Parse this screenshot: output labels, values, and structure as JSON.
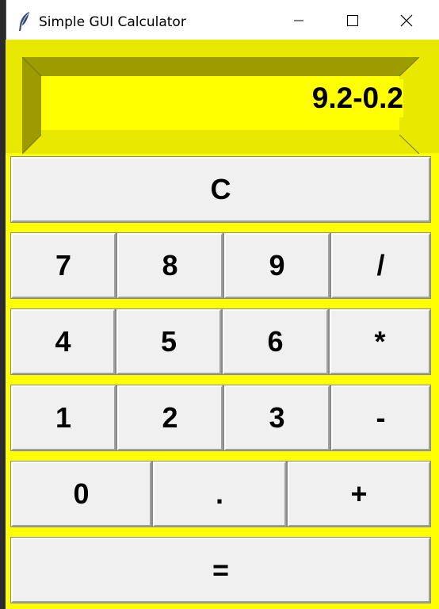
{
  "window": {
    "title": "Simple GUI Calculator",
    "controls": {
      "minimize_icon": "minimize-icon",
      "maximize_icon": "maximize-icon",
      "close_icon": "close-icon"
    },
    "app_icon": "feather-icon"
  },
  "display": {
    "value": "9.2-0.2"
  },
  "colors": {
    "background": "#ffff00",
    "frame": "#e8e800",
    "button_face": "#f0f0f0",
    "text": "#000000"
  },
  "keys": {
    "clear": "C",
    "seven": "7",
    "eight": "8",
    "nine": "9",
    "divide": "/",
    "four": "4",
    "five": "5",
    "six": "6",
    "multiply": "*",
    "one": "1",
    "two": "2",
    "three": "3",
    "subtract": "-",
    "zero": "0",
    "decimal": ".",
    "add": "+",
    "equals": "="
  }
}
